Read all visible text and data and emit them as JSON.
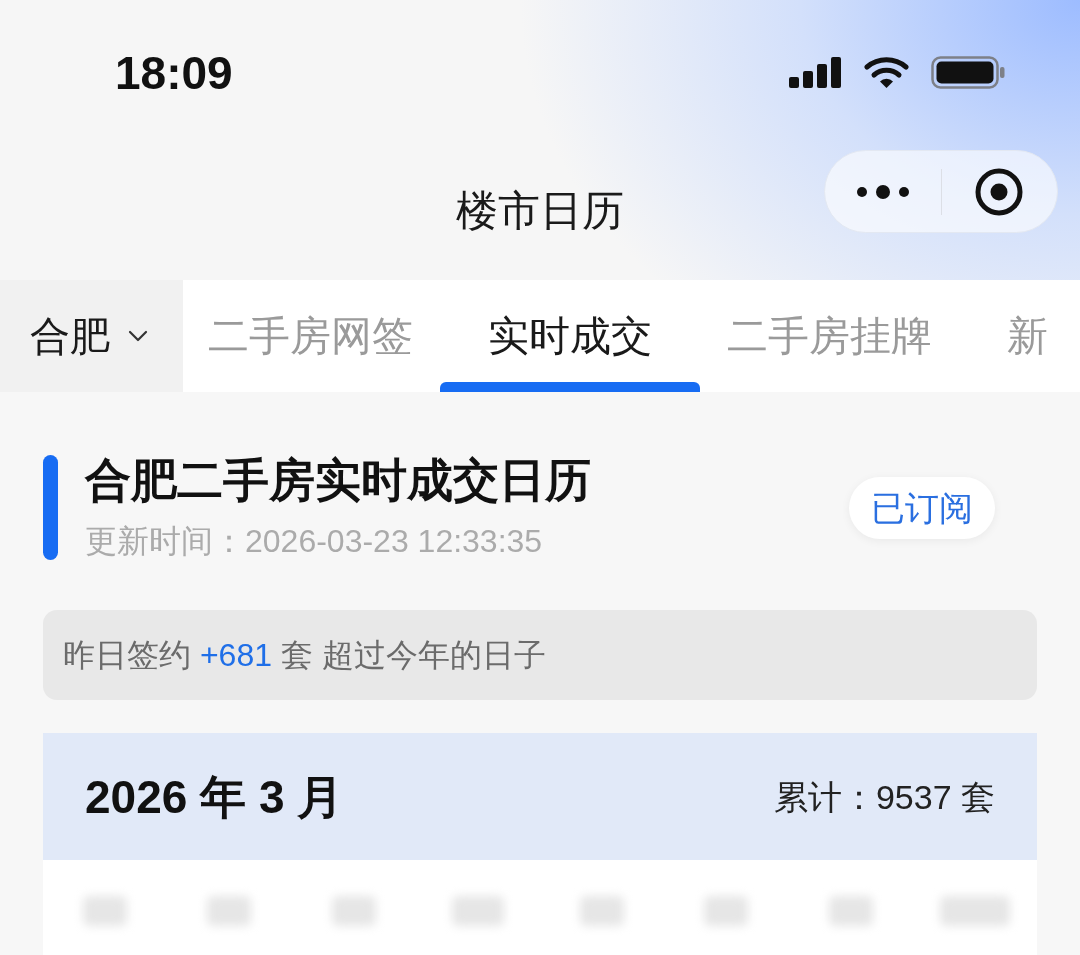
{
  "status_bar": {
    "time": "18:09"
  },
  "nav": {
    "title": "楼市日历"
  },
  "city": {
    "label": "合肥"
  },
  "tabs": [
    {
      "label": "二手房网签",
      "selected": false
    },
    {
      "label": "实时成交",
      "selected": true
    },
    {
      "label": "二手房挂牌",
      "selected": false
    },
    {
      "label": "新",
      "selected": false
    }
  ],
  "header": {
    "title": "合肥二手房实时成交日历",
    "updated": "更新时间：2026-03-23 12:33:35",
    "subscribe_button": "已订阅"
  },
  "summary": {
    "prefix": "昨日签约",
    "count": "+681",
    "suffix": "套 超过今年的日子"
  },
  "calendar": {
    "month": "2026 年 3 月",
    "total": "累计：9537 套"
  }
}
